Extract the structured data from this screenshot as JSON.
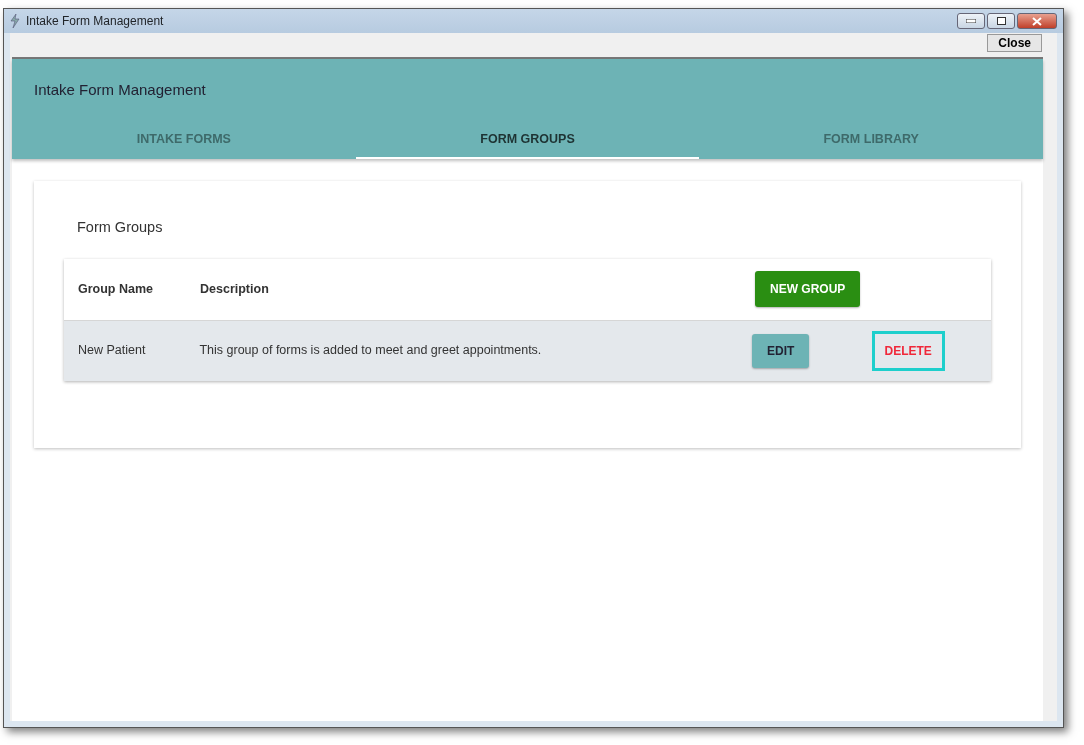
{
  "window": {
    "title": "Intake Form Management"
  },
  "toolbar": {
    "close_button": "Close"
  },
  "header": {
    "title": "Intake Form Management"
  },
  "tabs": [
    {
      "label": "INTAKE FORMS",
      "selected": false
    },
    {
      "label": "FORM GROUPS",
      "selected": true
    },
    {
      "label": "FORM LIBRARY",
      "selected": false
    }
  ],
  "panel": {
    "title": "Form Groups",
    "table": {
      "columns": [
        "Group Name",
        "Description"
      ],
      "new_button": "NEW GROUP",
      "rows": [
        {
          "name": "New Patient",
          "description": "This group of forms is added to meet and greet appointments.",
          "edit": "EDIT",
          "delete": "DELETE",
          "delete_highlighted": true
        }
      ]
    }
  }
}
